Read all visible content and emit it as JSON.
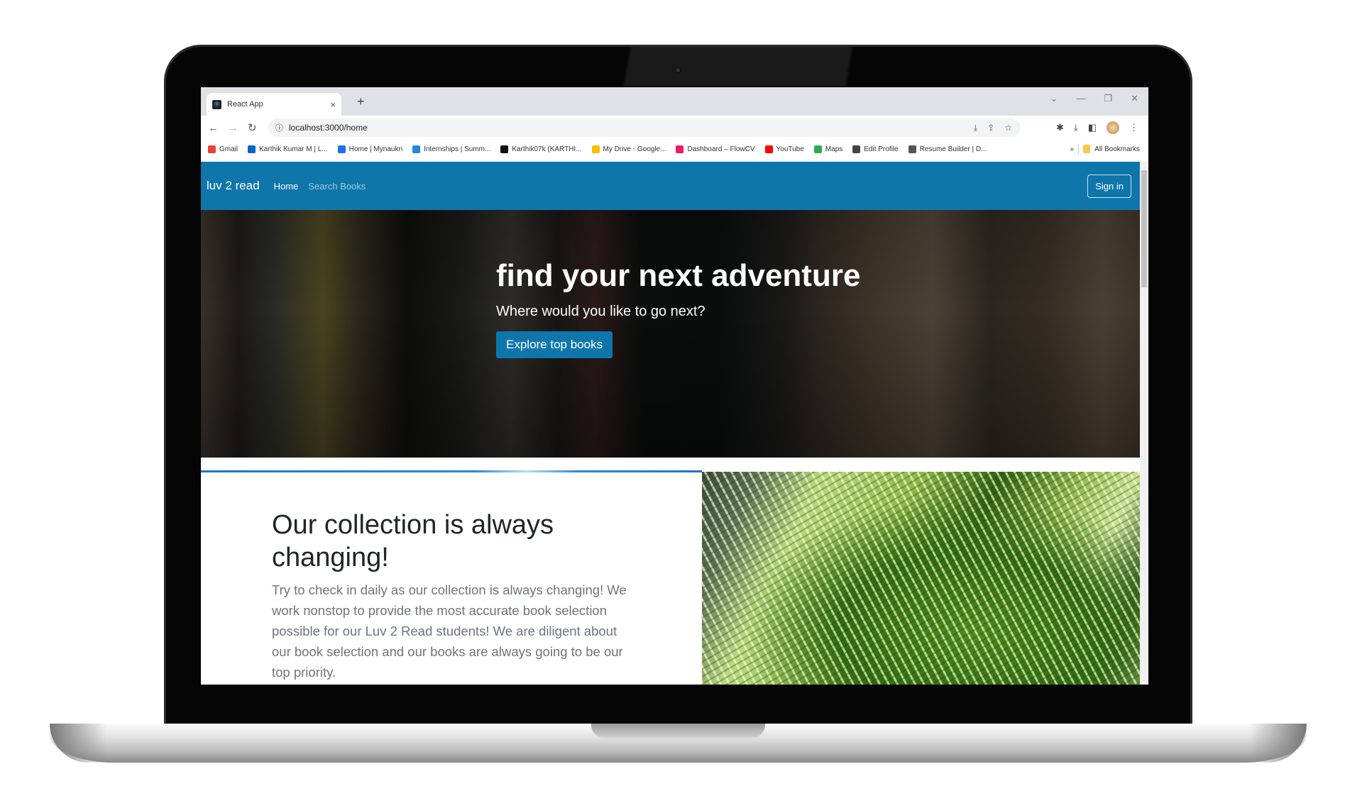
{
  "browser": {
    "tab_title": "React App",
    "url": "localhost:3000/home",
    "bookmarks": [
      {
        "label": "Gmail",
        "color": "#ea4335"
      },
      {
        "label": "Karthik Kumar M | L...",
        "color": "#0a66c2"
      },
      {
        "label": "Home | Mynaukri",
        "color": "#1a73e8"
      },
      {
        "label": "Internships | Summ...",
        "color": "#1e88e5"
      },
      {
        "label": "Karthik07k (KARTHI...",
        "color": "#111111"
      },
      {
        "label": "My Drive - Google...",
        "color": "#fbbc04"
      },
      {
        "label": "Dashboard – FlowCV",
        "color": "#e91e63"
      },
      {
        "label": "YouTube",
        "color": "#ff0000"
      },
      {
        "label": "Maps",
        "color": "#34a853"
      },
      {
        "label": "Edit Profile",
        "color": "#444444"
      },
      {
        "label": "Resume Builder | D...",
        "color": "#555555"
      }
    ],
    "overflow": "»",
    "all_bookmarks": "All Bookmarks"
  },
  "navbar": {
    "brand": "luv 2 read",
    "links": [
      "Home",
      "Search Books"
    ],
    "signin": "Sign in",
    "color": "#0f76ab"
  },
  "hero": {
    "title": "find your next adventure",
    "subtitle": "Where would you like to go next?",
    "button": "Explore top books"
  },
  "collection": {
    "heading": "Our collection is always changing!",
    "body": "Try to check in daily as our collection is always changing! We work nonstop to provide the most accurate book selection possible for our Luv 2 Read students! We are diligent about our book selection and our books are always going to be our top priority."
  }
}
